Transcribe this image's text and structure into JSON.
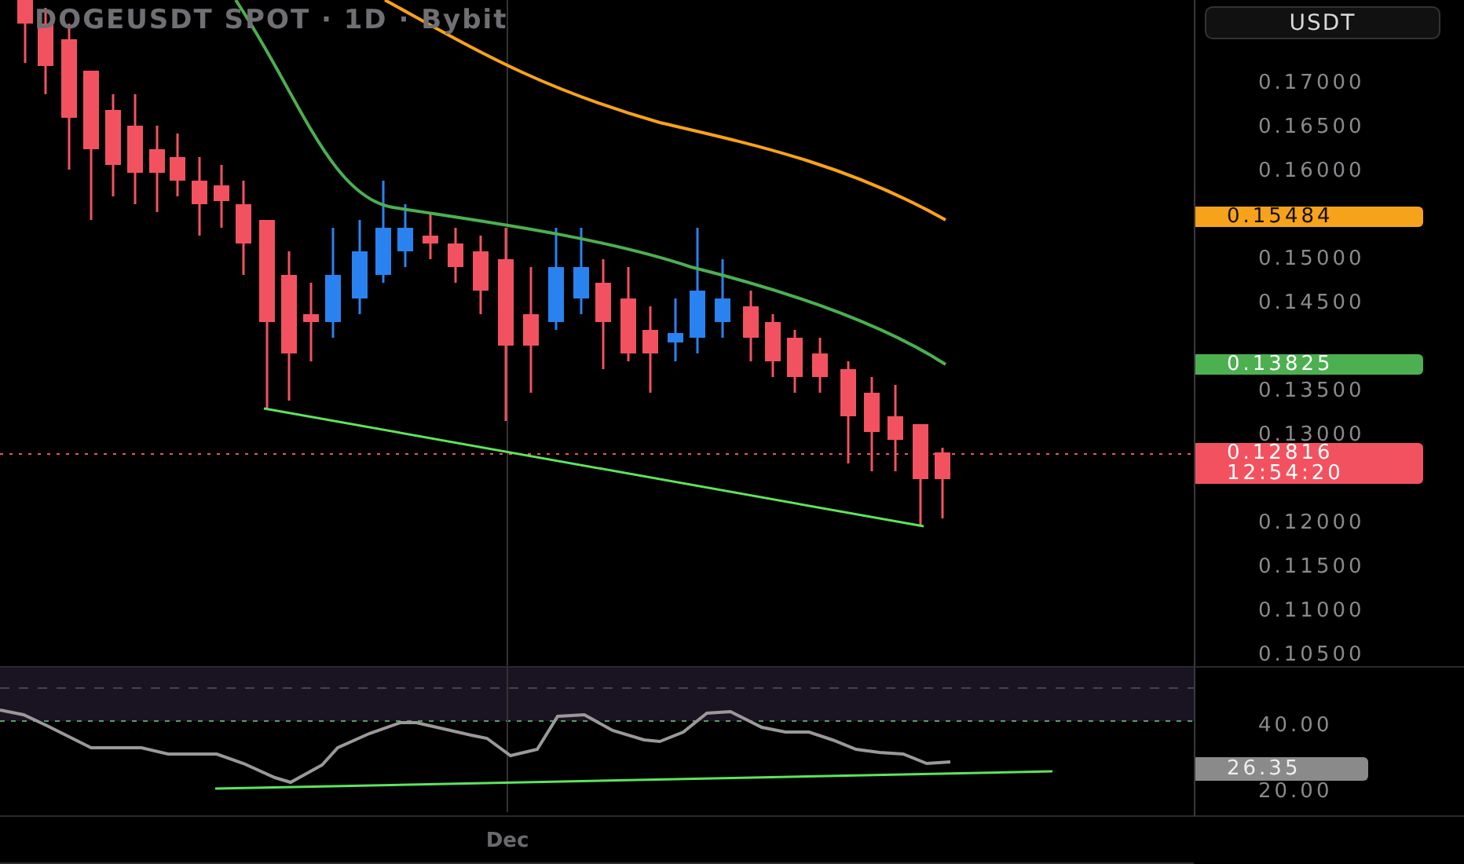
{
  "chart_title": "DOGEUSDT SPOT · 1D · Bybit",
  "currency_button": "USDT",
  "price_axis": {
    "ticks": [
      "0.17000",
      "0.16500",
      "0.16000",
      "0.15000",
      "0.14500",
      "0.13500",
      "0.13000",
      "0.12000",
      "0.11500",
      "0.11000",
      "0.10500"
    ],
    "markers": [
      {
        "kind": "slow_ma",
        "text": "0.15484"
      },
      {
        "kind": "fast_ma",
        "text": "0.13825"
      },
      {
        "kind": "last_price",
        "text": "0.12816",
        "countdown": "12:54:20"
      }
    ]
  },
  "rsi_axis": {
    "ticks": [
      "40.00",
      "20.00"
    ],
    "value": "26.35"
  },
  "time_axis": {
    "label": "Dec"
  }
}
